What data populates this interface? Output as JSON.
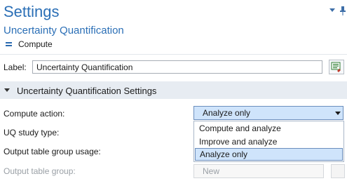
{
  "header": {
    "title": "Settings",
    "subtitle": "Uncertainty Quantification",
    "command_label": "Compute"
  },
  "label_field": {
    "label": "Label:",
    "value": "Uncertainty Quantification"
  },
  "section": {
    "title": "Uncertainty Quantification Settings"
  },
  "form": {
    "compute_action_label": "Compute action:",
    "compute_action_value": "Analyze only",
    "uq_study_type_label": "UQ study type:",
    "output_table_group_usage_label": "Output table group usage:",
    "output_table_group_label": "Output table group:",
    "output_table_group_value": "New"
  },
  "dropdown": {
    "options": [
      "Compute and analyze",
      "Improve and analyze",
      "Analyze only"
    ],
    "selected": "Analyze only"
  },
  "colors": {
    "title_blue": "#2b6fb6",
    "section_bg": "#e7ecf2",
    "selection_bg": "#cfe4fb"
  }
}
